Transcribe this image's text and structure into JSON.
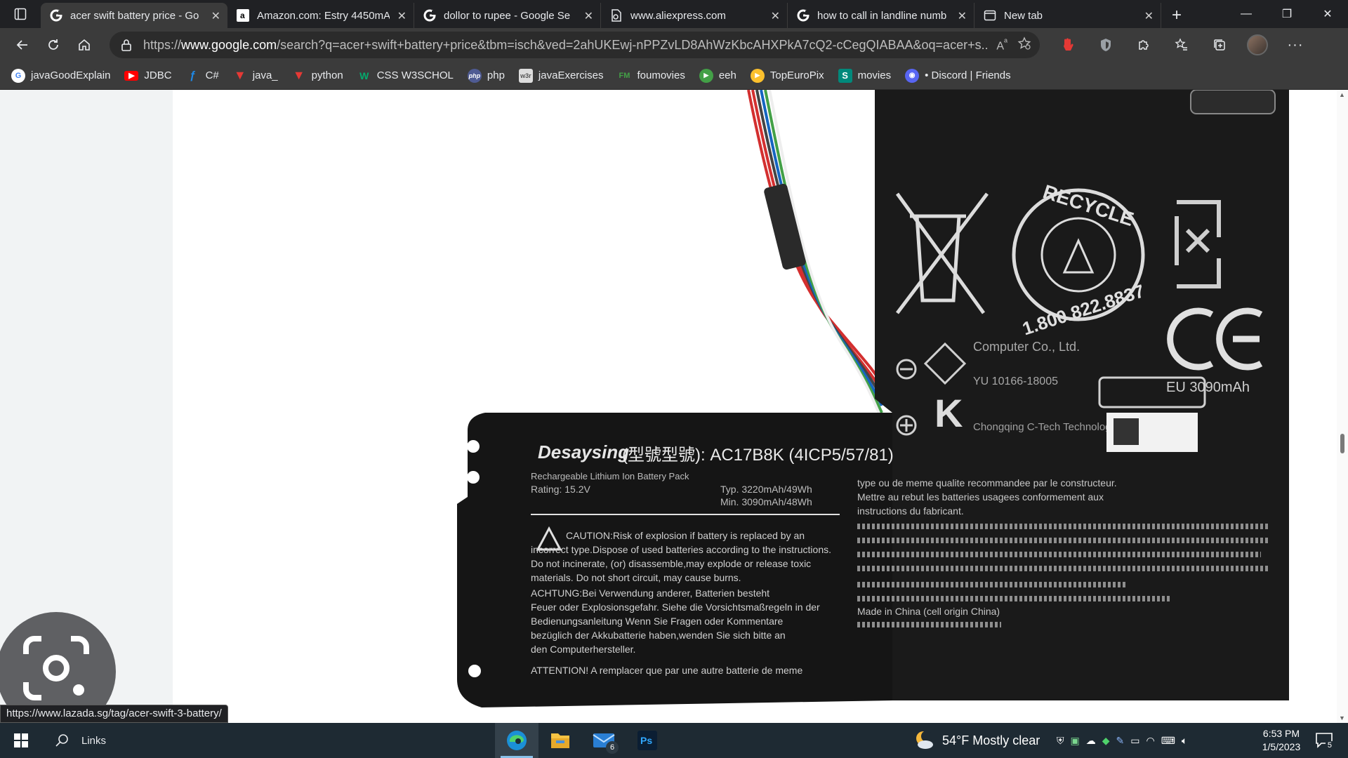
{
  "tabs": [
    {
      "title": "acer swift battery price - Go",
      "icon": "google-icon",
      "active": true
    },
    {
      "title": "Amazon.com: Estry 4450mA",
      "icon": "amazon-icon",
      "active": false
    },
    {
      "title": "dollor to rupee - Google Se",
      "icon": "google-icon",
      "active": false
    },
    {
      "title": "www.aliexpress.com",
      "icon": "page-icon",
      "active": false
    },
    {
      "title": "how to call in landline numb",
      "icon": "google-icon",
      "active": false
    },
    {
      "title": "New tab",
      "icon": "newtab-icon",
      "active": false
    }
  ],
  "address_bar": {
    "url_prefix": "https://",
    "url_domain": "www.google.com",
    "url_rest": "/search?q=acer+swift+battery+price&tbm=isch&ved=2ahUKEwj-nPPZvLD8AhWzKbcAHXPkA7cQ2-cCegQIABAA&oq=acer+s..."
  },
  "bookmarks": [
    {
      "label": "javaGoodExplain",
      "icon": "google-icon",
      "color": "#ffffff"
    },
    {
      "label": "JDBC",
      "icon": "youtube-icon",
      "color": "#ff0000"
    },
    {
      "label": "C#",
      "icon": "csharp-icon",
      "color": "#1e88e5"
    },
    {
      "label": "java_",
      "icon": "java-icon",
      "color": "#e53935"
    },
    {
      "label": "python",
      "icon": "python-icon",
      "color": "#e53935"
    },
    {
      "label": "CSS W3SCHOL",
      "icon": "w3schools-icon",
      "color": "#04aa6d"
    },
    {
      "label": "php",
      "icon": "php-icon",
      "color": "#4f5b93"
    },
    {
      "label": "javaExercises",
      "icon": "w3r-icon",
      "color": "#dddddd"
    },
    {
      "label": "foumovies",
      "icon": "fm-icon",
      "color": "#2e7d32"
    },
    {
      "label": "eeh",
      "icon": "play-icon",
      "color": "#43a047"
    },
    {
      "label": "TopEuroPix",
      "icon": "topeuropix-icon",
      "color": "#fbc02d"
    },
    {
      "label": "movies",
      "icon": "s-icon",
      "color": "#00897b"
    },
    {
      "label": "• Discord | Friends",
      "icon": "discord-icon",
      "color": "#5865f2"
    }
  ],
  "image": {
    "model_label": "(型號型號): AC17B8K (4ICP5/57/81)",
    "brand": "Desaysing",
    "pack_desc": "Rechargeable Lithium Ion Battery Pack",
    "rating": "Rating: 15.2V",
    "typ_capacity": "Typ. 3220mAh/49Wh",
    "min_capacity": "Min. 3090mAh/48Wh",
    "recycle_text": "RECYCLE",
    "recycle_phone": "1.800.822.8837",
    "eu_capacity": "EU 3090mAh",
    "caution": "CAUTION:Risk of explosion if battery is replaced by an incorrect type.Dispose of used batteries according to the instructions. Do not incinerate, (or) disassemble,may explode or release toxic materials. Do not short circuit, may cause burns.",
    "achtung": "ACHTUNG:Bei Verwendung anderer, Batterien besteht Feuer oder Explosionsgefahr. Siehe die Vorsichtsmaßregeln in der Bedienungsanleitung Wenn Sie Fragen oder Kommentare bezüglich der Akkubatterie haben,wenden Sie sich bitte an den Computerhersteller.",
    "attention": "ATTENTION! A remplacer que par une autre batterie de meme",
    "french_right": "type ou de meme qualite recommandee par le constructeur. Mettre au rebut les batteries usagees conformement aux instructions du fabricant.",
    "made_in": "Made in China (cell origin China)",
    "company": "Computer Co., Ltd.",
    "kc_code": "YU 10166-18005",
    "chongqing": "Chongqing C-Tech Technology Co., Ltd"
  },
  "status_url": "https://www.lazada.sg/tag/acer-swift-3-battery/",
  "taskbar": {
    "search_label": "Links",
    "mail_badge": "6",
    "weather": "54°F  Mostly clear",
    "time": "6:53 PM",
    "date": "1/5/2023",
    "notification_count": "5",
    "apps": [
      "edge-icon",
      "file-explorer-icon",
      "mail-icon",
      "photoshop-icon"
    ]
  }
}
